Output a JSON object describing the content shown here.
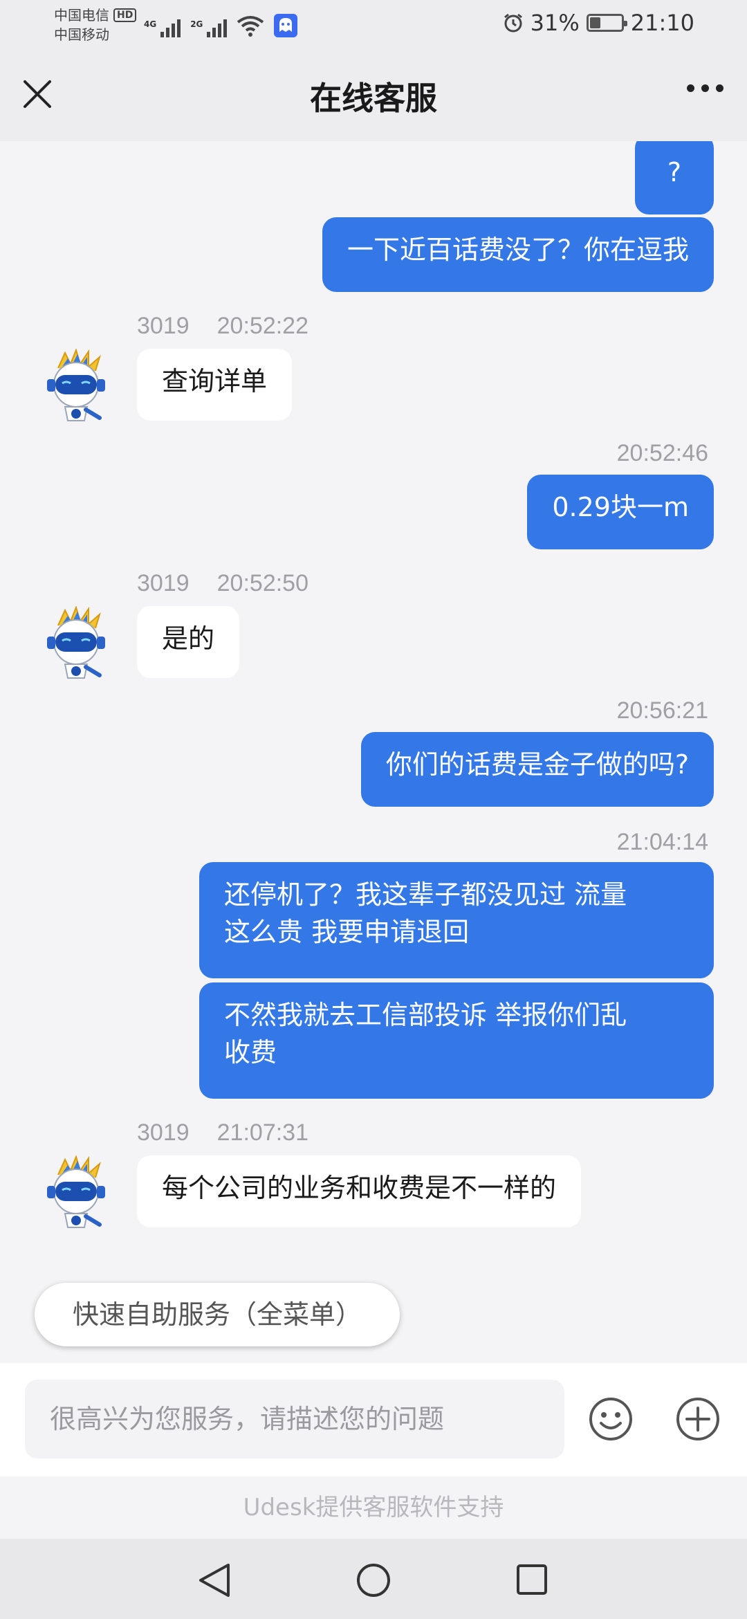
{
  "status_bar": {
    "carrier1": "中国电信",
    "hd_badge": "HD",
    "carrier2": "中国移动",
    "net1": "4G",
    "net2": "2G",
    "battery_percent": "31%",
    "battery_level": 0.31,
    "time": "21:10"
  },
  "header": {
    "title": "在线客服"
  },
  "messages": [
    {
      "type": "outgoing",
      "text": "?"
    },
    {
      "type": "outgoing",
      "text": "一下近百话费没了？你在逗我"
    },
    {
      "type": "incoming",
      "agent_id": "3019",
      "time": "20:52:22",
      "text": "查询详单"
    },
    {
      "type": "outgoing",
      "time": "20:52:46",
      "text": "0.29块一m"
    },
    {
      "type": "incoming",
      "agent_id": "3019",
      "time": "20:52:50",
      "text": "是的"
    },
    {
      "type": "outgoing",
      "time": "20:56:21",
      "text": "你们的话费是金子做的吗?"
    },
    {
      "type": "outgoing",
      "time": "21:04:14",
      "line1": "还停机了？我这辈子都没见过 流量",
      "line2": "这么贵 我要申请退回"
    },
    {
      "type": "outgoing",
      "line1": "不然我就去工信部投诉 举报你们乱",
      "line2": "收费"
    },
    {
      "type": "incoming",
      "agent_id": "3019",
      "time": "21:07:31",
      "text": "每个公司的业务和收费是不一样的"
    }
  ],
  "quick_service": {
    "label": "快速自助服务（全菜单）"
  },
  "input": {
    "placeholder": "很高兴为您服务，请描述您的问题"
  },
  "footer": {
    "powered_by": "Udesk提供客服软件支持"
  },
  "icons": {
    "close": "close-icon",
    "more": "more-icon",
    "emoji": "emoji-icon",
    "plus": "plus-icon",
    "back": "back-icon",
    "home": "home-icon",
    "recent": "recent-apps-icon"
  },
  "colors": {
    "outgoing_bubble": "#3478e8",
    "incoming_bubble": "#ffffff",
    "background": "#f4f4f6"
  }
}
